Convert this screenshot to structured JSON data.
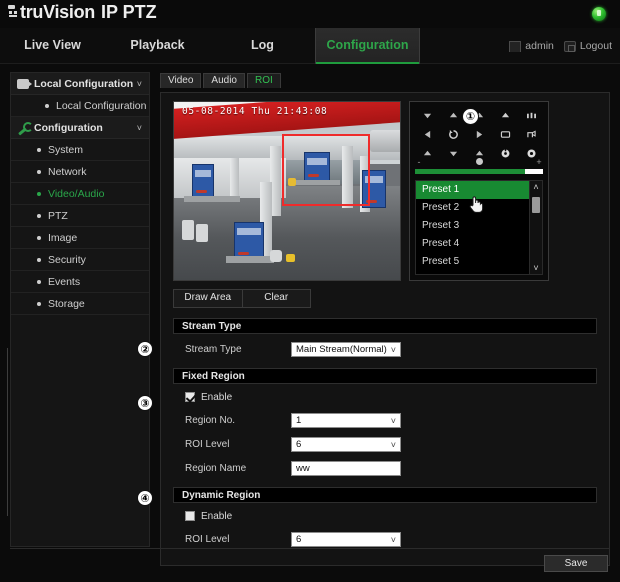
{
  "brand": {
    "prefix": "truVision",
    "product": "IP PTZ",
    "status_icon": "status-indicator-green"
  },
  "nav": {
    "tabs": [
      {
        "label": "Live View",
        "active": false
      },
      {
        "label": "Playback",
        "active": false
      },
      {
        "label": "Log",
        "active": false
      },
      {
        "label": "Configuration",
        "active": true
      }
    ],
    "user": "admin",
    "logout": "Logout"
  },
  "sidebar": {
    "groups": [
      {
        "label": "Local Configuration",
        "icon": "camera-icon",
        "chevron": "˅",
        "items": [
          {
            "label": "Local Configuration",
            "active": false
          }
        ]
      },
      {
        "label": "Configuration",
        "icon": "wrench-icon",
        "chevron": "˅",
        "items": [
          {
            "label": "System",
            "active": false
          },
          {
            "label": "Network",
            "active": false
          },
          {
            "label": "Video/Audio",
            "active": true
          },
          {
            "label": "PTZ",
            "active": false
          },
          {
            "label": "Image",
            "active": false
          },
          {
            "label": "Security",
            "active": false
          },
          {
            "label": "Events",
            "active": false
          },
          {
            "label": "Storage",
            "active": false
          }
        ]
      }
    ]
  },
  "content_tabs": [
    {
      "label": "Video",
      "active": false
    },
    {
      "label": "Audio",
      "active": false
    },
    {
      "label": "ROI",
      "active": true
    }
  ],
  "video": {
    "timestamp": "05-08-2014 Thu 21:43:08",
    "roi_rectangle": "red-roi-rectangle"
  },
  "ptz": {
    "marker": "①",
    "buttons": [
      "pan-left-down-icon",
      "pan-up-icon",
      "pan-right-up-icon",
      "zoom-in-icon",
      "focus-far-icon",
      "pan-left-icon",
      "auto-scan-icon",
      "pan-right-icon",
      "iris-open-icon",
      "light-icon",
      "pan-left-up-icon",
      "pan-down-icon",
      "pan-right-down-icon",
      "wiper-icon",
      "aux-focus-icon"
    ],
    "speed_minus": "-",
    "speed_plus": "+",
    "presets": [
      {
        "label": "Preset 1",
        "selected": true
      },
      {
        "label": "Preset 2",
        "selected": false
      },
      {
        "label": "Preset 3",
        "selected": false
      },
      {
        "label": "Preset 4",
        "selected": false
      },
      {
        "label": "Preset 5",
        "selected": false
      }
    ],
    "scroll_up": "˄",
    "scroll_down": "˅",
    "cursor": "hand-pointer-cursor"
  },
  "draw_tools": {
    "draw_area": "Draw Area",
    "clear": "Clear"
  },
  "stream_type": {
    "marker": "②",
    "heading": "Stream Type",
    "label": "Stream Type",
    "value": "Main Stream(Normal)",
    "chevron": "˅"
  },
  "fixed_region": {
    "marker": "③",
    "heading": "Fixed Region",
    "enable_label": "Enable",
    "enabled": true,
    "region_no_label": "Region No.",
    "region_no_value": "1",
    "roi_level_label": "ROI Level",
    "roi_level_value": "6",
    "region_name_label": "Region Name",
    "region_name_value": "ww",
    "chevron": "˅"
  },
  "dynamic_region": {
    "marker": "④",
    "heading": "Dynamic Region",
    "enable_label": "Enable",
    "enabled": false,
    "roi_level_label": "ROI Level",
    "roi_level_value": "6",
    "chevron": "˅"
  },
  "footer": {
    "save": "Save"
  },
  "colors": {
    "accent_green": "#2aa74a",
    "roi_red": "#ef2b2b",
    "select_green": "#188a32"
  }
}
